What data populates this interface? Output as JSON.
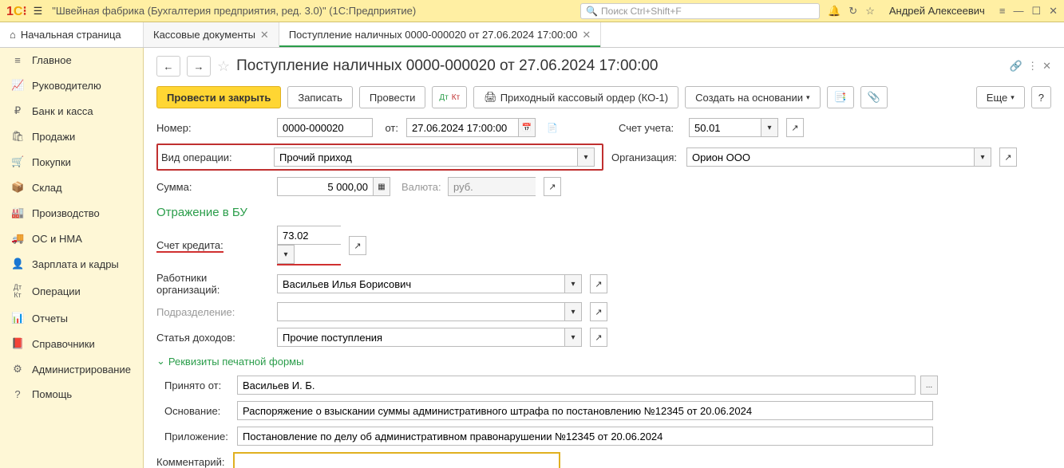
{
  "titlebar": {
    "app_title": "\"Швейная фабрика (Бухгалтерия предприятия, ред. 3.0)\"  (1С:Предприятие)",
    "search_placeholder": "Поиск Ctrl+Shift+F",
    "user": "Андрей Алексеевич"
  },
  "tabs": {
    "home": "Начальная страница",
    "tab1": "Кассовые документы",
    "tab2": "Поступление наличных 0000-000020 от 27.06.2024 17:00:00"
  },
  "sidebar": [
    "Главное",
    "Руководителю",
    "Банк и касса",
    "Продажи",
    "Покупки",
    "Склад",
    "Производство",
    "ОС и НМА",
    "Зарплата и кадры",
    "Операции",
    "Отчеты",
    "Справочники",
    "Администрирование",
    "Помощь"
  ],
  "doc": {
    "title": "Поступление наличных 0000-000020 от 27.06.2024 17:00:00",
    "toolbar": {
      "post_close": "Провести и закрыть",
      "save": "Записать",
      "post": "Провести",
      "print_order": "Приходный кассовый ордер (КО-1)",
      "create_based": "Создать на основании",
      "more": "Еще"
    },
    "labels": {
      "number": "Номер:",
      "from": "от:",
      "account": "Счет учета:",
      "op_type": "Вид операции:",
      "org": "Организация:",
      "sum": "Сумма:",
      "currency": "Валюта:",
      "section_bu": "Отражение в БУ",
      "credit_account": "Счет кредита:",
      "employee": "Работники организаций:",
      "dept": "Подразделение:",
      "income_item": "Статья доходов:",
      "print_section": "Реквизиты печатной формы",
      "received_from": "Принято от:",
      "basis": "Основание:",
      "attachment": "Приложение:",
      "comment": "Комментарий:"
    },
    "values": {
      "number": "0000-000020",
      "date": "27.06.2024 17:00:00",
      "account": "50.01",
      "op_type": "Прочий приход",
      "org": "Орион ООО",
      "sum": "5 000,00",
      "currency": "руб.",
      "credit_account": "73.02",
      "employee": "Васильев Илья Борисович",
      "dept": "",
      "income_item": "Прочие поступления",
      "received_from": "Васильев И. Б.",
      "basis": "Распоряжение о взыскании суммы административного штрафа по постановлению №12345 от 20.06.2024",
      "attachment": "Постановление по делу об административном правонарушении №12345 от 20.06.2024",
      "comment": ""
    }
  }
}
